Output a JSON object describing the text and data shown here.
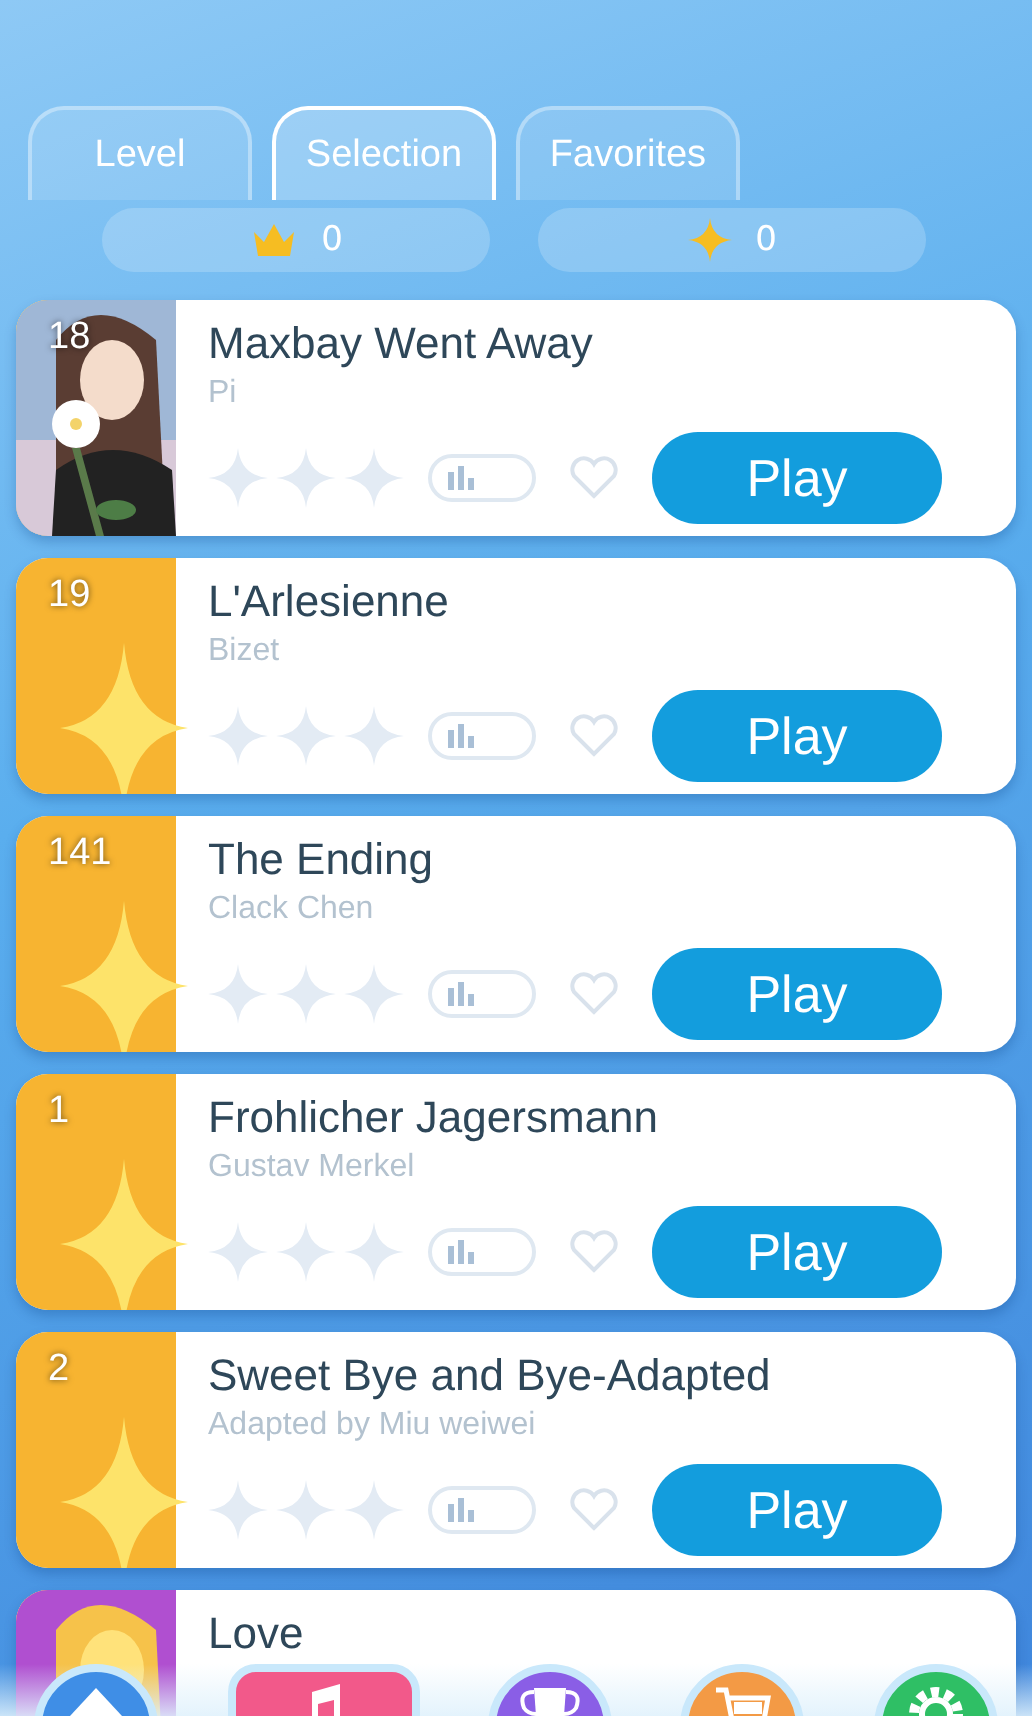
{
  "tabs": [
    {
      "label": "Level",
      "selected": false
    },
    {
      "label": "Selection",
      "selected": true
    },
    {
      "label": "Favorites",
      "selected": false
    }
  ],
  "stats": [
    {
      "kind": "crown",
      "value": "0"
    },
    {
      "kind": "sparkle",
      "value": "0"
    }
  ],
  "songs": [
    {
      "number": "18",
      "title": "Maxbay Went Away",
      "artist": "Pi",
      "kind": "picture",
      "stars": 0,
      "favorite": false,
      "button": "Play"
    },
    {
      "number": "19",
      "title": "L'Arlesienne",
      "artist": "Bizet",
      "kind": "star",
      "stars": 0,
      "favorite": false,
      "button": "Play"
    },
    {
      "number": "141",
      "title": "The Ending",
      "artist": "Clack Chen",
      "kind": "star",
      "stars": 0,
      "favorite": false,
      "button": "Play"
    },
    {
      "number": "1",
      "title": "Frohlicher Jagersmann",
      "artist": "Gustav Merkel",
      "kind": "star",
      "stars": 0,
      "favorite": false,
      "button": "Play"
    },
    {
      "number": "2",
      "title": "Sweet Bye and Bye-Adapted",
      "artist": "Adapted by Miu weiwei",
      "kind": "star",
      "stars": 0,
      "favorite": false,
      "button": "Play"
    },
    {
      "title": "Love",
      "kind": "picture"
    }
  ],
  "nav": [
    {
      "kind": "home",
      "selected": false
    },
    {
      "kind": "music",
      "selected": true
    },
    {
      "kind": "trophy",
      "selected": false
    },
    {
      "kind": "cart",
      "selected": false
    },
    {
      "kind": "settings",
      "selected": false
    }
  ]
}
